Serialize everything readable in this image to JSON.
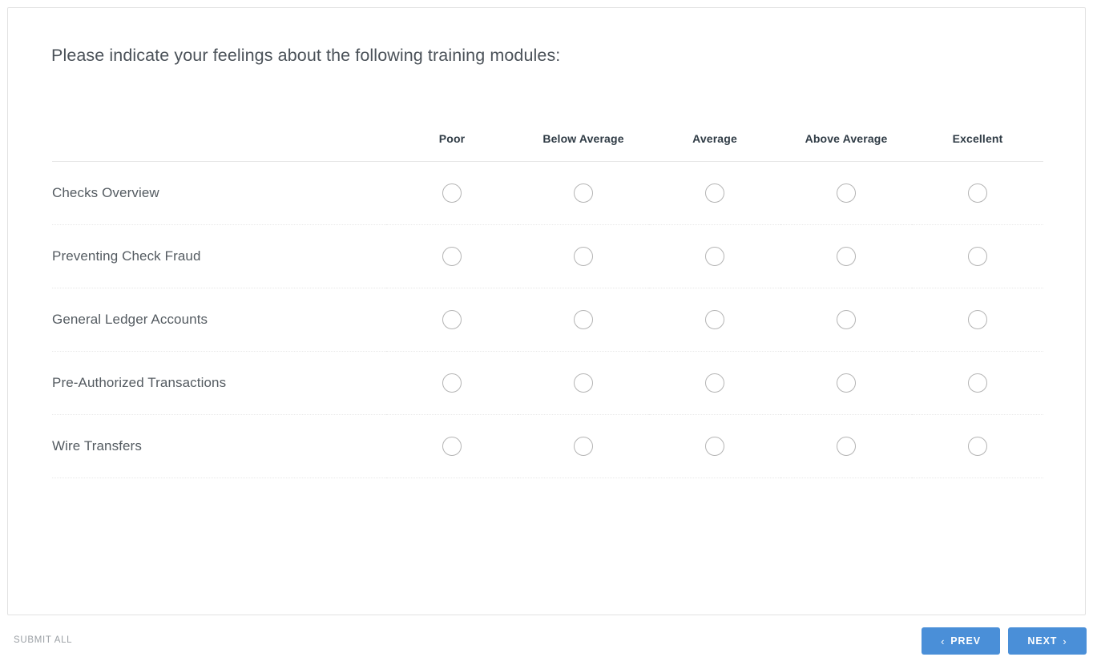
{
  "survey": {
    "question": "Please indicate your feelings about the following training modules:",
    "columns": [
      {
        "label": "Poor"
      },
      {
        "label": "Below Average"
      },
      {
        "label": "Average"
      },
      {
        "label": "Above Average"
      },
      {
        "label": "Excellent"
      }
    ],
    "rows": [
      {
        "label": "Checks Overview",
        "selected": null
      },
      {
        "label": "Preventing Check Fraud",
        "selected": null
      },
      {
        "label": "General Ledger Accounts",
        "selected": null
      },
      {
        "label": "Pre-Authorized Transactions",
        "selected": null
      },
      {
        "label": "Wire Transfers",
        "selected": null
      }
    ]
  },
  "footer": {
    "submit_all_label": "SUBMIT ALL",
    "prev_label": "PREV",
    "next_label": "NEXT",
    "prev_icon": "chevron-left-icon",
    "next_icon": "chevron-right-icon",
    "prev_glyph": "‹",
    "next_glyph": "›"
  },
  "colors": {
    "button_blue": "#4a8fd8",
    "heading_text": "#4b5259",
    "header_text": "#2f3b45",
    "row_label_text": "#545b61",
    "radio_border": "#b4b4b4",
    "card_border": "#e2e2e2",
    "submit_text": "#9ba0a5"
  }
}
